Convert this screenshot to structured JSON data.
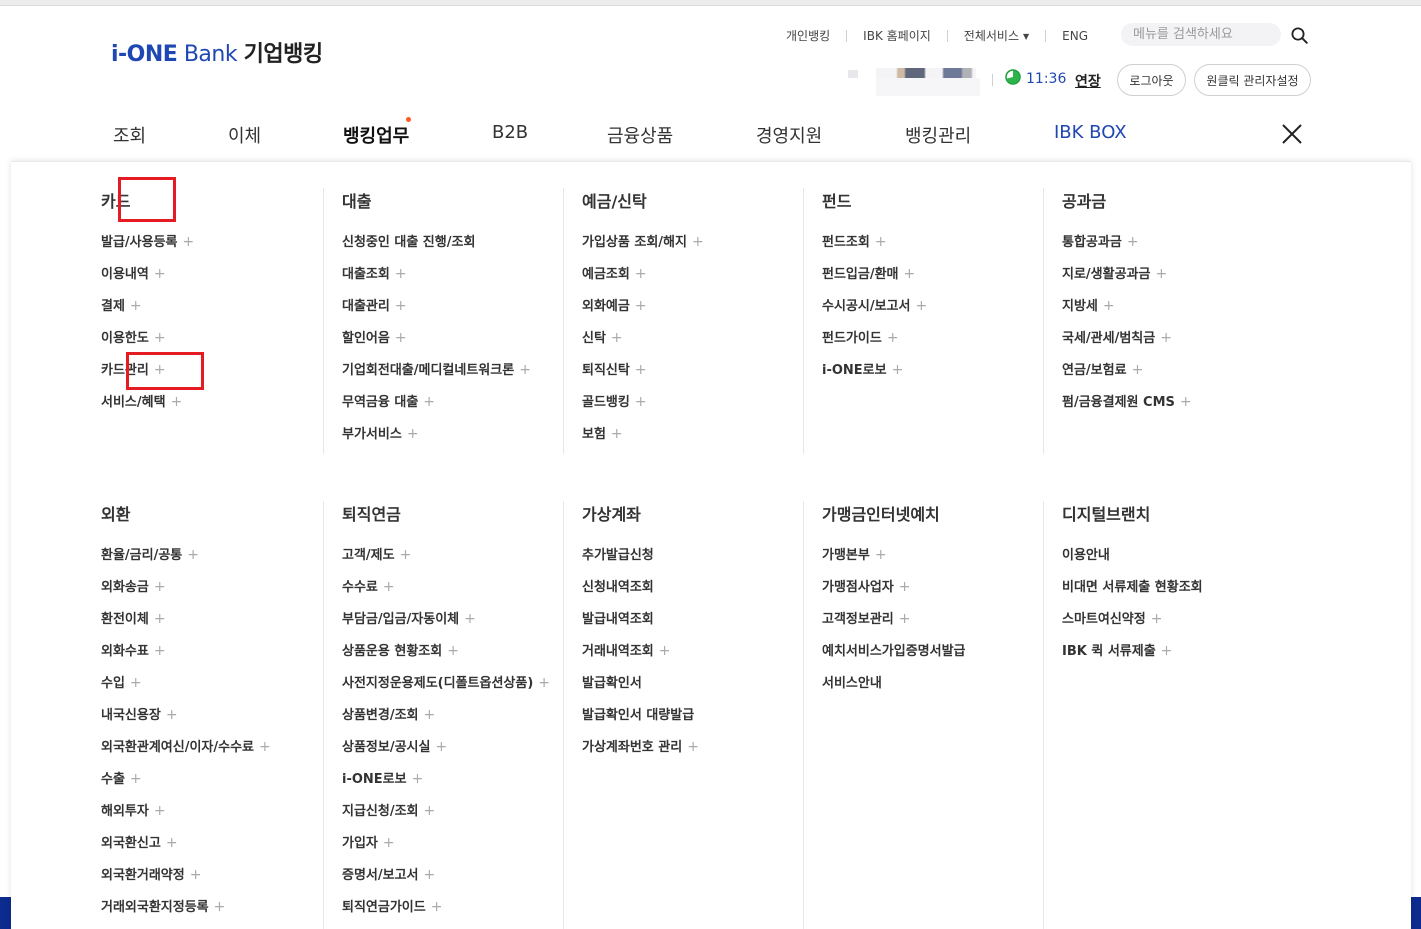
{
  "logo": {
    "part1": "i-ONE",
    "part2": "Bank",
    "part3": "기업뱅킹"
  },
  "util": {
    "items": [
      "개인뱅킹",
      "IBK 홈페이지",
      "전체서비스",
      "ENG"
    ],
    "search_placeholder": "메뉴를 검색하세요"
  },
  "session": {
    "time": "11:36",
    "extend": "연장",
    "logout": "로그아웃",
    "admin": "원클릭 관리자설정"
  },
  "gnb": {
    "items": [
      "조회",
      "이체",
      "뱅킹업무",
      "B2B",
      "금융상품",
      "경영지원",
      "뱅킹관리",
      "IBK BOX"
    ],
    "active_index": 2
  },
  "colors": {
    "accent": "#1f47b4",
    "highlight": "#e41b23",
    "dot": "#ff5a1f"
  },
  "menu": {
    "row1": [
      {
        "title": "카드",
        "items": [
          {
            "label": "발급/사용등록",
            "plus": "+"
          },
          {
            "label": "이용내역",
            "plus": "+"
          },
          {
            "label": "결제",
            "plus": "+"
          },
          {
            "label": "이용한도",
            "plus": "+"
          },
          {
            "label": "카드관리",
            "plus": "+"
          },
          {
            "label": "서비스/혜택",
            "plus": "+"
          }
        ]
      },
      {
        "title": "대출",
        "items": [
          {
            "label": "신청중인 대출 진행/조회",
            "plus": ""
          },
          {
            "label": "대출조회",
            "plus": "+"
          },
          {
            "label": "대출관리",
            "plus": "+"
          },
          {
            "label": "할인어음",
            "plus": "+"
          },
          {
            "label": "기업회전대출/메디컬네트워크론",
            "plus": "+"
          },
          {
            "label": "무역금융 대출",
            "plus": "+"
          },
          {
            "label": "부가서비스",
            "plus": "+"
          }
        ]
      },
      {
        "title": "예금/신탁",
        "items": [
          {
            "label": "가입상품 조회/해지",
            "plus": "+"
          },
          {
            "label": "예금조회",
            "plus": "+"
          },
          {
            "label": "외화예금",
            "plus": "+"
          },
          {
            "label": "신탁",
            "plus": "+"
          },
          {
            "label": "퇴직신탁",
            "plus": "+"
          },
          {
            "label": "골드뱅킹",
            "plus": "+"
          },
          {
            "label": "보험",
            "plus": "+"
          }
        ]
      },
      {
        "title": "펀드",
        "items": [
          {
            "label": "펀드조회",
            "plus": "+"
          },
          {
            "label": "펀드입금/환매",
            "plus": "+"
          },
          {
            "label": "수시공시/보고서",
            "plus": "+"
          },
          {
            "label": "펀드가이드",
            "plus": "+"
          },
          {
            "label": "i-ONE로보",
            "plus": "+"
          }
        ]
      },
      {
        "title": "공과금",
        "items": [
          {
            "label": "통합공과금",
            "plus": "+"
          },
          {
            "label": "지로/생활공과금",
            "plus": "+"
          },
          {
            "label": "지방세",
            "plus": "+"
          },
          {
            "label": "국세/관세/범칙금",
            "plus": "+"
          },
          {
            "label": "연금/보험료",
            "plus": "+"
          },
          {
            "label": "펌/금융결제원 CMS",
            "plus": "+"
          }
        ]
      }
    ],
    "row2": [
      {
        "title": "외환",
        "items": [
          {
            "label": "환율/금리/공통",
            "plus": "+"
          },
          {
            "label": "외화송금",
            "plus": "+"
          },
          {
            "label": "환전이체",
            "plus": "+"
          },
          {
            "label": "외화수표",
            "plus": "+"
          },
          {
            "label": "수입",
            "plus": "+"
          },
          {
            "label": "내국신용장",
            "plus": "+"
          },
          {
            "label": "외국환관계여신/이자/수수료",
            "plus": "+"
          },
          {
            "label": "수출",
            "plus": "+"
          },
          {
            "label": "해외투자",
            "plus": "+"
          },
          {
            "label": "외국환신고",
            "plus": "+"
          },
          {
            "label": "외국환거래약정",
            "plus": "+"
          },
          {
            "label": "거래외국환지정등록",
            "plus": "+"
          }
        ]
      },
      {
        "title": "퇴직연금",
        "items": [
          {
            "label": "고객/제도",
            "plus": "+"
          },
          {
            "label": "수수료",
            "plus": "+"
          },
          {
            "label": "부담금/입금/자동이체",
            "plus": "+"
          },
          {
            "label": "상품운용 현황조회",
            "plus": "+"
          },
          {
            "label": "사전지정운용제도(디폴트옵션상품)",
            "plus": "+"
          },
          {
            "label": "상품변경/조회",
            "plus": "+"
          },
          {
            "label": "상품정보/공시실",
            "plus": "+"
          },
          {
            "label": "i-ONE로보",
            "plus": "+"
          },
          {
            "label": "지급신청/조회",
            "plus": "+"
          },
          {
            "label": "가입자",
            "plus": "+"
          },
          {
            "label": "증명서/보고서",
            "plus": "+"
          },
          {
            "label": "퇴직연금가이드",
            "plus": "+"
          }
        ]
      },
      {
        "title": "가상계좌",
        "items": [
          {
            "label": "추가발급신청",
            "plus": ""
          },
          {
            "label": "신청내역조회",
            "plus": ""
          },
          {
            "label": "발급내역조회",
            "plus": ""
          },
          {
            "label": "거래내역조회",
            "plus": "+"
          },
          {
            "label": "발급확인서",
            "plus": ""
          },
          {
            "label": "발급확인서 대량발급",
            "plus": ""
          },
          {
            "label": "가상계좌번호 관리",
            "plus": "+"
          }
        ]
      },
      {
        "title": "가맹금인터넷예치",
        "items": [
          {
            "label": "가맹본부",
            "plus": "+"
          },
          {
            "label": "가맹점사업자",
            "plus": "+"
          },
          {
            "label": "고객정보관리",
            "plus": "+"
          },
          {
            "label": "예치서비스가입증명서발급",
            "plus": ""
          },
          {
            "label": "서비스안내",
            "plus": ""
          }
        ]
      },
      {
        "title": "디지털브랜치",
        "items": [
          {
            "label": "이용안내",
            "plus": ""
          },
          {
            "label": "비대면 서류제출 현황조회",
            "plus": ""
          },
          {
            "label": "스마트여신약정",
            "plus": "+"
          },
          {
            "label": "IBK 퀵 서류제출",
            "plus": "+"
          }
        ]
      }
    ]
  }
}
